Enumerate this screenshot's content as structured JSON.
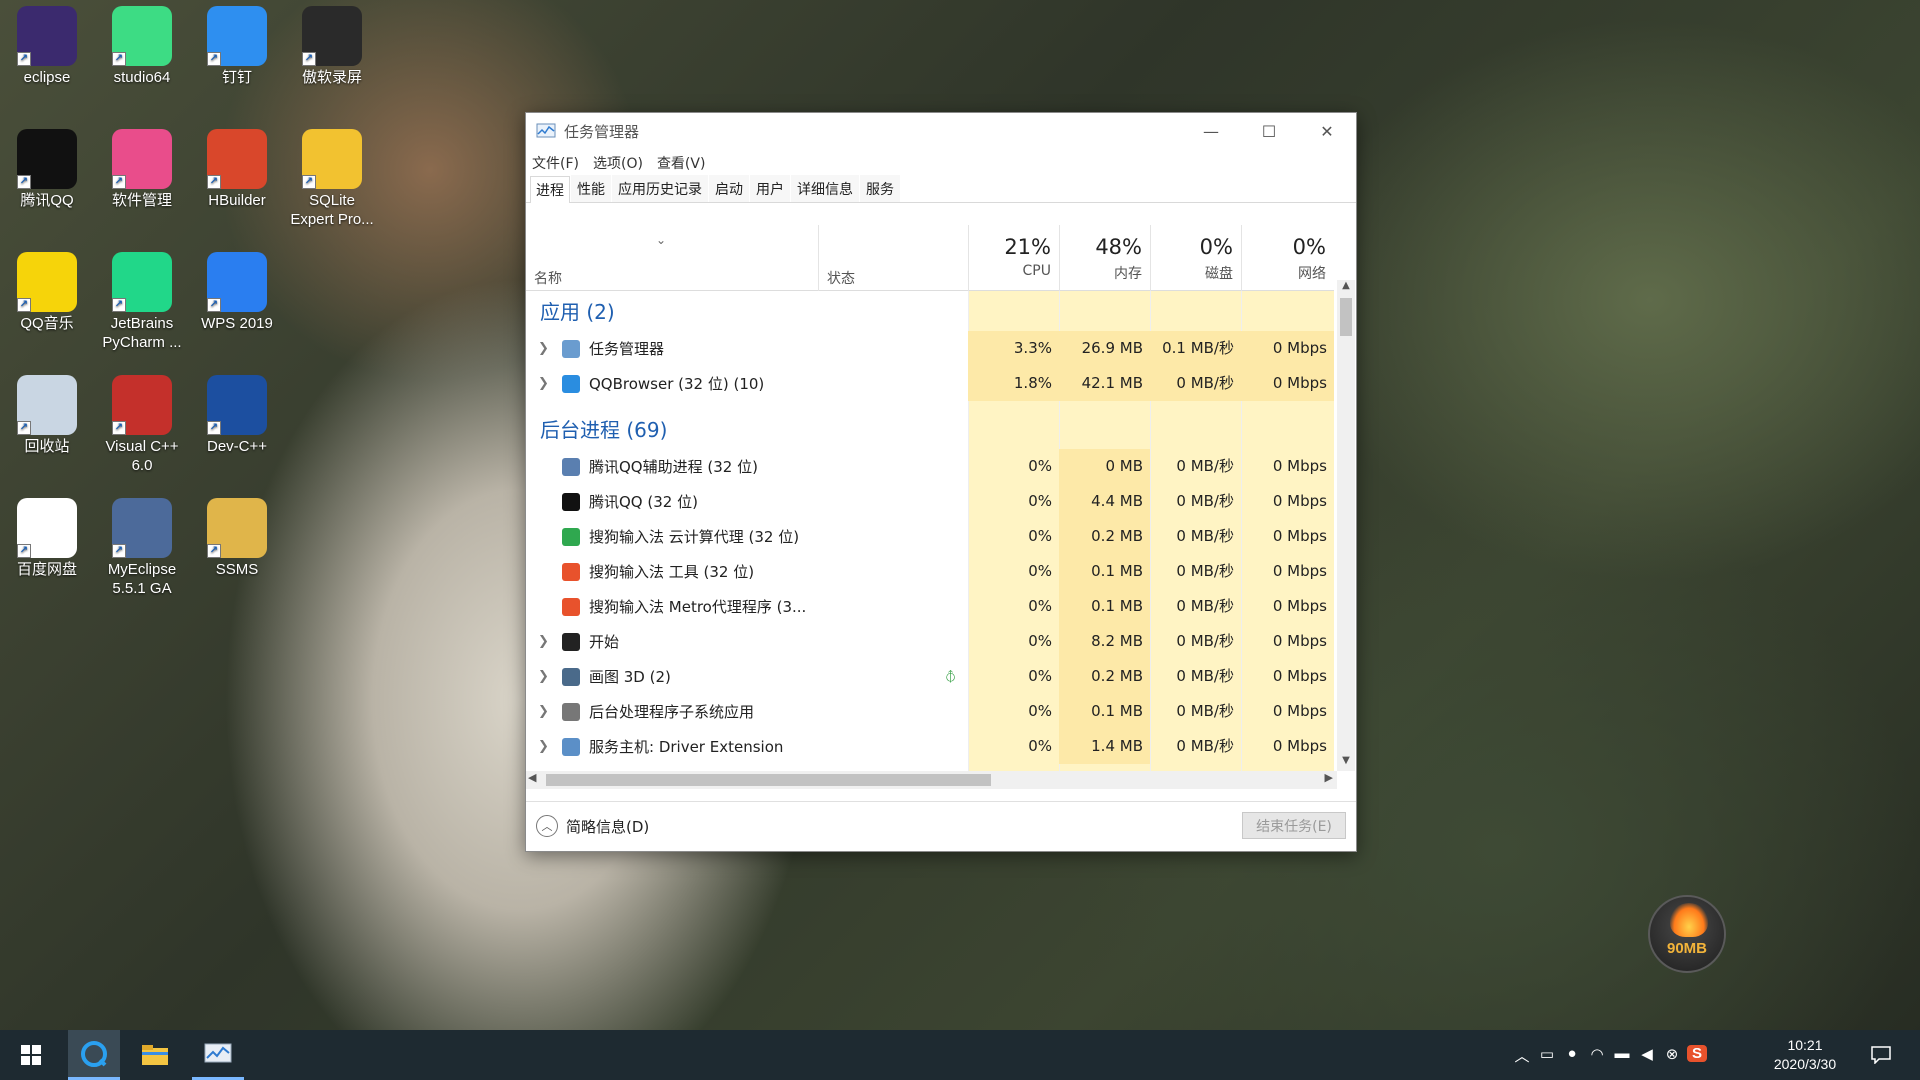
{
  "desktop": {
    "icons": [
      {
        "label": "eclipse",
        "color": "#3b2a6e"
      },
      {
        "label": "studio64",
        "color": "#3ddc84"
      },
      {
        "label": "钉钉",
        "color": "#2e8ff0"
      },
      {
        "label": "傲软录屏",
        "color": "#2a2a2a"
      },
      {
        "label": "腾讯QQ",
        "color": "#111111"
      },
      {
        "label": "软件管理",
        "color": "#e94d8b"
      },
      {
        "label": "HBuilder",
        "color": "#d9472b"
      },
      {
        "label": "SQLite Expert Pro...",
        "color": "#f2c230"
      },
      {
        "label": "QQ音乐",
        "color": "#f6d40a"
      },
      {
        "label": "JetBrains PyCharm ...",
        "color": "#21d789"
      },
      {
        "label": "WPS 2019",
        "color": "#2a7ef0"
      },
      {
        "label": "回收站",
        "color": "#c9d6e3"
      },
      {
        "label": "Visual C++ 6.0",
        "color": "#c4302b"
      },
      {
        "label": "Dev-C++",
        "color": "#1c4fa0"
      },
      {
        "label": "百度网盘",
        "color": "#ffffff"
      },
      {
        "label": "MyEclipse 5.5.1 GA",
        "color": "#4c6a9a"
      },
      {
        "label": "SSMS",
        "color": "#e0b54a"
      }
    ],
    "float_widget": {
      "label": "90MB"
    }
  },
  "window": {
    "title": "任务管理器",
    "controls": {
      "minimize": "—",
      "maximize": "☐",
      "close": "✕"
    },
    "menu": [
      "文件(F)",
      "选项(O)",
      "查看(V)"
    ],
    "tabs": [
      "进程",
      "性能",
      "应用历史记录",
      "启动",
      "用户",
      "详细信息",
      "服务"
    ],
    "columns": {
      "name": "名称",
      "status": "状态",
      "cpu": {
        "pct": "21%",
        "label": "CPU"
      },
      "memory": {
        "pct": "48%",
        "label": "内存"
      },
      "disk": {
        "pct": "0%",
        "label": "磁盘"
      },
      "network": {
        "pct": "0%",
        "label": "网络"
      }
    },
    "groups": {
      "apps": "应用 (2)",
      "background": "后台进程 (69)"
    },
    "app_rows": [
      {
        "name": "任务管理器",
        "cpu": "3.3%",
        "mem": "26.9 MB",
        "disk": "0.1 MB/秒",
        "net": "0 Mbps",
        "expand": true,
        "icon": "#6a9ccf"
      },
      {
        "name": "QQBrowser (32 位) (10)",
        "cpu": "1.8%",
        "mem": "42.1 MB",
        "disk": "0 MB/秒",
        "net": "0 Mbps",
        "expand": true,
        "icon": "#2a8de0"
      }
    ],
    "bg_rows": [
      {
        "name": "腾讯QQ辅助进程 (32 位)",
        "cpu": "0%",
        "mem": "0 MB",
        "disk": "0 MB/秒",
        "net": "0 Mbps",
        "expand": false,
        "icon": "#5a7fb0"
      },
      {
        "name": "腾讯QQ (32 位)",
        "cpu": "0%",
        "mem": "4.4 MB",
        "disk": "0 MB/秒",
        "net": "0 Mbps",
        "expand": false,
        "icon": "#111111"
      },
      {
        "name": "搜狗输入法 云计算代理 (32 位)",
        "cpu": "0%",
        "mem": "0.2 MB",
        "disk": "0 MB/秒",
        "net": "0 Mbps",
        "expand": false,
        "icon": "#2fa84f"
      },
      {
        "name": "搜狗输入法 工具 (32 位)",
        "cpu": "0%",
        "mem": "0.1 MB",
        "disk": "0 MB/秒",
        "net": "0 Mbps",
        "expand": false,
        "icon": "#e8522c"
      },
      {
        "name": "搜狗输入法 Metro代理程序 (3...",
        "cpu": "0%",
        "mem": "0.1 MB",
        "disk": "0 MB/秒",
        "net": "0 Mbps",
        "expand": false,
        "icon": "#e8522c"
      },
      {
        "name": "开始",
        "cpu": "0%",
        "mem": "8.2 MB",
        "disk": "0 MB/秒",
        "net": "0 Mbps",
        "expand": true,
        "icon": "#222222"
      },
      {
        "name": "画图 3D (2)",
        "cpu": "0%",
        "mem": "0.2 MB",
        "disk": "0 MB/秒",
        "net": "0 Mbps",
        "expand": true,
        "icon": "#4a6a8a",
        "suspended": true
      },
      {
        "name": "后台处理程序子系统应用",
        "cpu": "0%",
        "mem": "0.1 MB",
        "disk": "0 MB/秒",
        "net": "0 Mbps",
        "expand": true,
        "icon": "#777777"
      },
      {
        "name": "服务主机: Driver Extension",
        "cpu": "0%",
        "mem": "1.4 MB",
        "disk": "0 MB/秒",
        "net": "0 Mbps",
        "expand": true,
        "icon": "#5b8fc7"
      }
    ],
    "footer": {
      "fewer_details": "简略信息(D)",
      "end_task": "结束任务(E)"
    }
  },
  "taskbar": {
    "clock_time": "10:21",
    "clock_date": "2020/3/30",
    "tray_icons": [
      "chevron-up-icon",
      "tablet-icon",
      "qq-tray-icon",
      "wifi-icon",
      "battery-icon",
      "volume-icon",
      "close-circle-icon",
      "sogou-icon"
    ]
  },
  "colors": {
    "accent": "#1f5fb0",
    "heat_light": "#fff4c4",
    "heat_mid": "#fde9a8",
    "taskbar": "#1e2a31"
  }
}
